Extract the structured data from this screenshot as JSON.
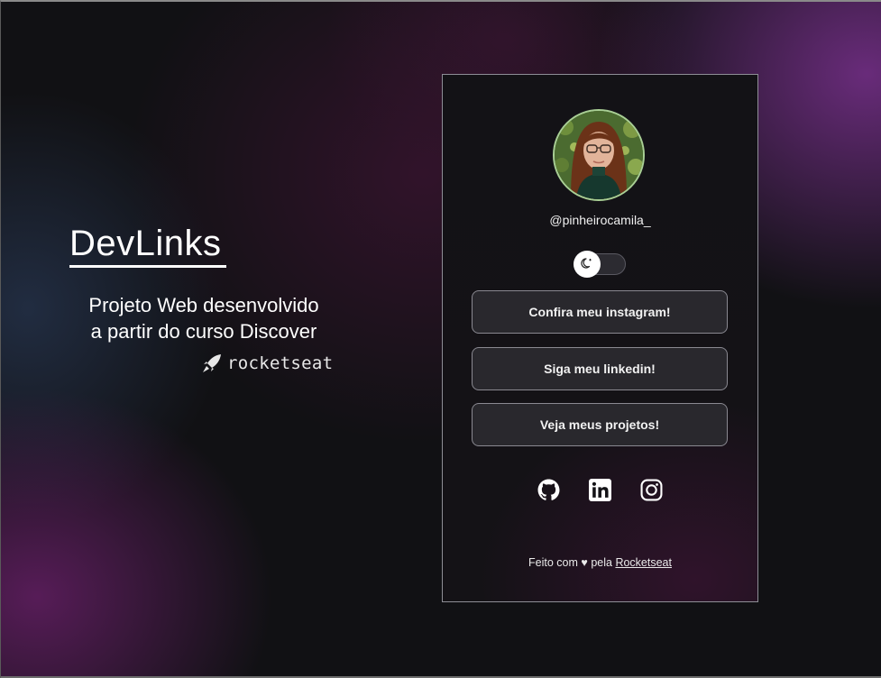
{
  "intro": {
    "title": "DevLinks",
    "description_line1": "Projeto Web desenvolvido",
    "description_line2": "a partir do curso Discover",
    "logo_text": "rocketseat"
  },
  "profile": {
    "username": "@pinheirocamila_",
    "theme_toggle_icon": "moon-icon",
    "theme_toggle_state": "dark"
  },
  "links": [
    {
      "label": "Confira meu instagram!"
    },
    {
      "label": "Siga meu linkedin!"
    },
    {
      "label": "Veja meus projetos!"
    }
  ],
  "social_icons": [
    "github-icon",
    "linkedin-icon",
    "instagram-icon"
  ],
  "footer": {
    "prefix": "Feito com",
    "heart": "♥",
    "middle": "pela",
    "link_text": "Rocketseat"
  },
  "colors": {
    "accent_purple": "#7a3090",
    "card_background": "#131216",
    "button_background": "#29282d",
    "text": "#ffffff"
  }
}
